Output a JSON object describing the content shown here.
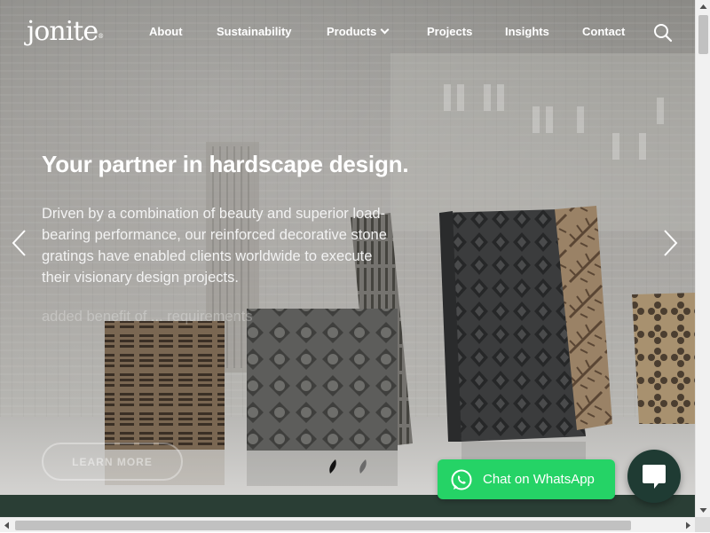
{
  "brand": {
    "logo_text": "jonite",
    "logo_mark": "®"
  },
  "nav": {
    "items": [
      {
        "label": "About"
      },
      {
        "label": "Sustainability"
      },
      {
        "label": "Products"
      },
      {
        "label": "Projects"
      },
      {
        "label": "Insights"
      },
      {
        "label": "Contact"
      }
    ]
  },
  "hero": {
    "headline": "Your partner in hardscape design.",
    "lead": "Driven by a combination of beauty and superior load-bearing performance, our reinforced decorative stone gratings have enabled clients worldwide to execute their visionary design projects.",
    "ghost_text": "added benefit of ... requirements",
    "cta_label": "LEARN MORE",
    "slide_count": 2,
    "active_slide": 1
  },
  "whatsapp": {
    "label": "Chat on WhatsApp"
  },
  "colors": {
    "accent_green": "#25d366",
    "dark_green": "#2a3e35",
    "chat_bubble": "#1f3b33",
    "text_white": "#ffffff"
  },
  "icons": {
    "search": "search-icon",
    "prev": "chevron-left-icon",
    "next": "chevron-right-icon",
    "whatsapp": "whatsapp-icon",
    "chat": "chat-icon"
  }
}
